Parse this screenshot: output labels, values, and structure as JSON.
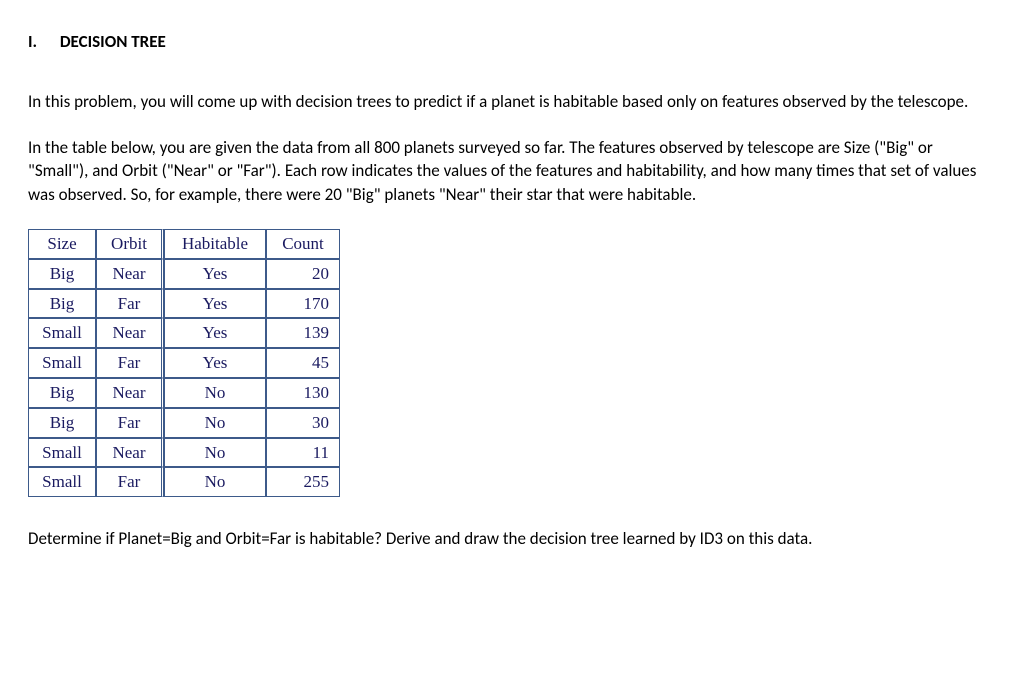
{
  "heading": {
    "number": "I.",
    "title": "DECISION TREE"
  },
  "paragraphs": {
    "intro": "In this problem, you will come up with decision trees to predict if a planet is habitable based only on features observed by the telescope.",
    "description": "In the table below, you are given the data from all 800 planets surveyed so far. The features observed by telescope are Size (\"Big\" or \"Small\"), and Orbit (\"Near\" or \"Far\"). Each row indicates the values of the features and habitability, and how many times that set of values was observed. So, for example, there were 20 \"Big\" planets \"Near\" their star that were habitable.",
    "question": "Determine if Planet=Big and Orbit=Far is habitable? Derive and draw the decision tree learned by ID3 on this data."
  },
  "table": {
    "headers": {
      "size": "Size",
      "orbit": "Orbit",
      "habitable": "Habitable",
      "count": "Count"
    },
    "rows": [
      {
        "size": "Big",
        "orbit": "Near",
        "habitable": "Yes",
        "count": "20"
      },
      {
        "size": "Big",
        "orbit": "Far",
        "habitable": "Yes",
        "count": "170"
      },
      {
        "size": "Small",
        "orbit": "Near",
        "habitable": "Yes",
        "count": "139"
      },
      {
        "size": "Small",
        "orbit": "Far",
        "habitable": "Yes",
        "count": "45"
      },
      {
        "size": "Big",
        "orbit": "Near",
        "habitable": "No",
        "count": "130"
      },
      {
        "size": "Big",
        "orbit": "Far",
        "habitable": "No",
        "count": "30"
      },
      {
        "size": "Small",
        "orbit": "Near",
        "habitable": "No",
        "count": "11"
      },
      {
        "size": "Small",
        "orbit": "Far",
        "habitable": "No",
        "count": "255"
      }
    ]
  }
}
